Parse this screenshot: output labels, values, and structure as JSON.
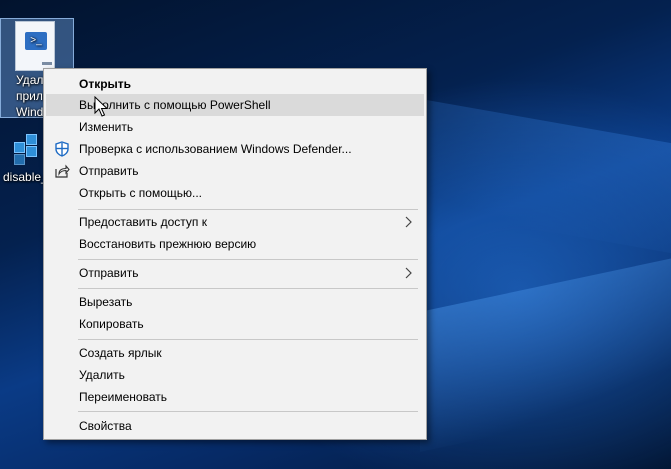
{
  "desktop": {
    "icon1": {
      "lines": [
        "Удали",
        "прилож",
        "Windov"
      ]
    },
    "icon2": {
      "label": "disable_"
    }
  },
  "menu": {
    "items": [
      {
        "label": "Открыть",
        "bold": true
      },
      {
        "label": "Выполнить с помощью PowerShell",
        "hover": true
      },
      {
        "label": "Изменить"
      },
      {
        "label": "Проверка с использованием Windows Defender...",
        "icon": "windows-defender-icon"
      },
      {
        "label": "Отправить",
        "icon": "share-icon"
      },
      {
        "label": "Открыть с помощью..."
      },
      {
        "label": "Предоставить доступ к",
        "submenu": true
      },
      {
        "label": "Восстановить прежнюю версию"
      },
      {
        "label": "Отправить",
        "submenu": true
      },
      {
        "label": "Вырезать"
      },
      {
        "label": "Копировать"
      },
      {
        "label": "Создать ярлык"
      },
      {
        "label": "Удалить"
      },
      {
        "label": "Переименовать"
      },
      {
        "label": "Свойства"
      }
    ]
  }
}
